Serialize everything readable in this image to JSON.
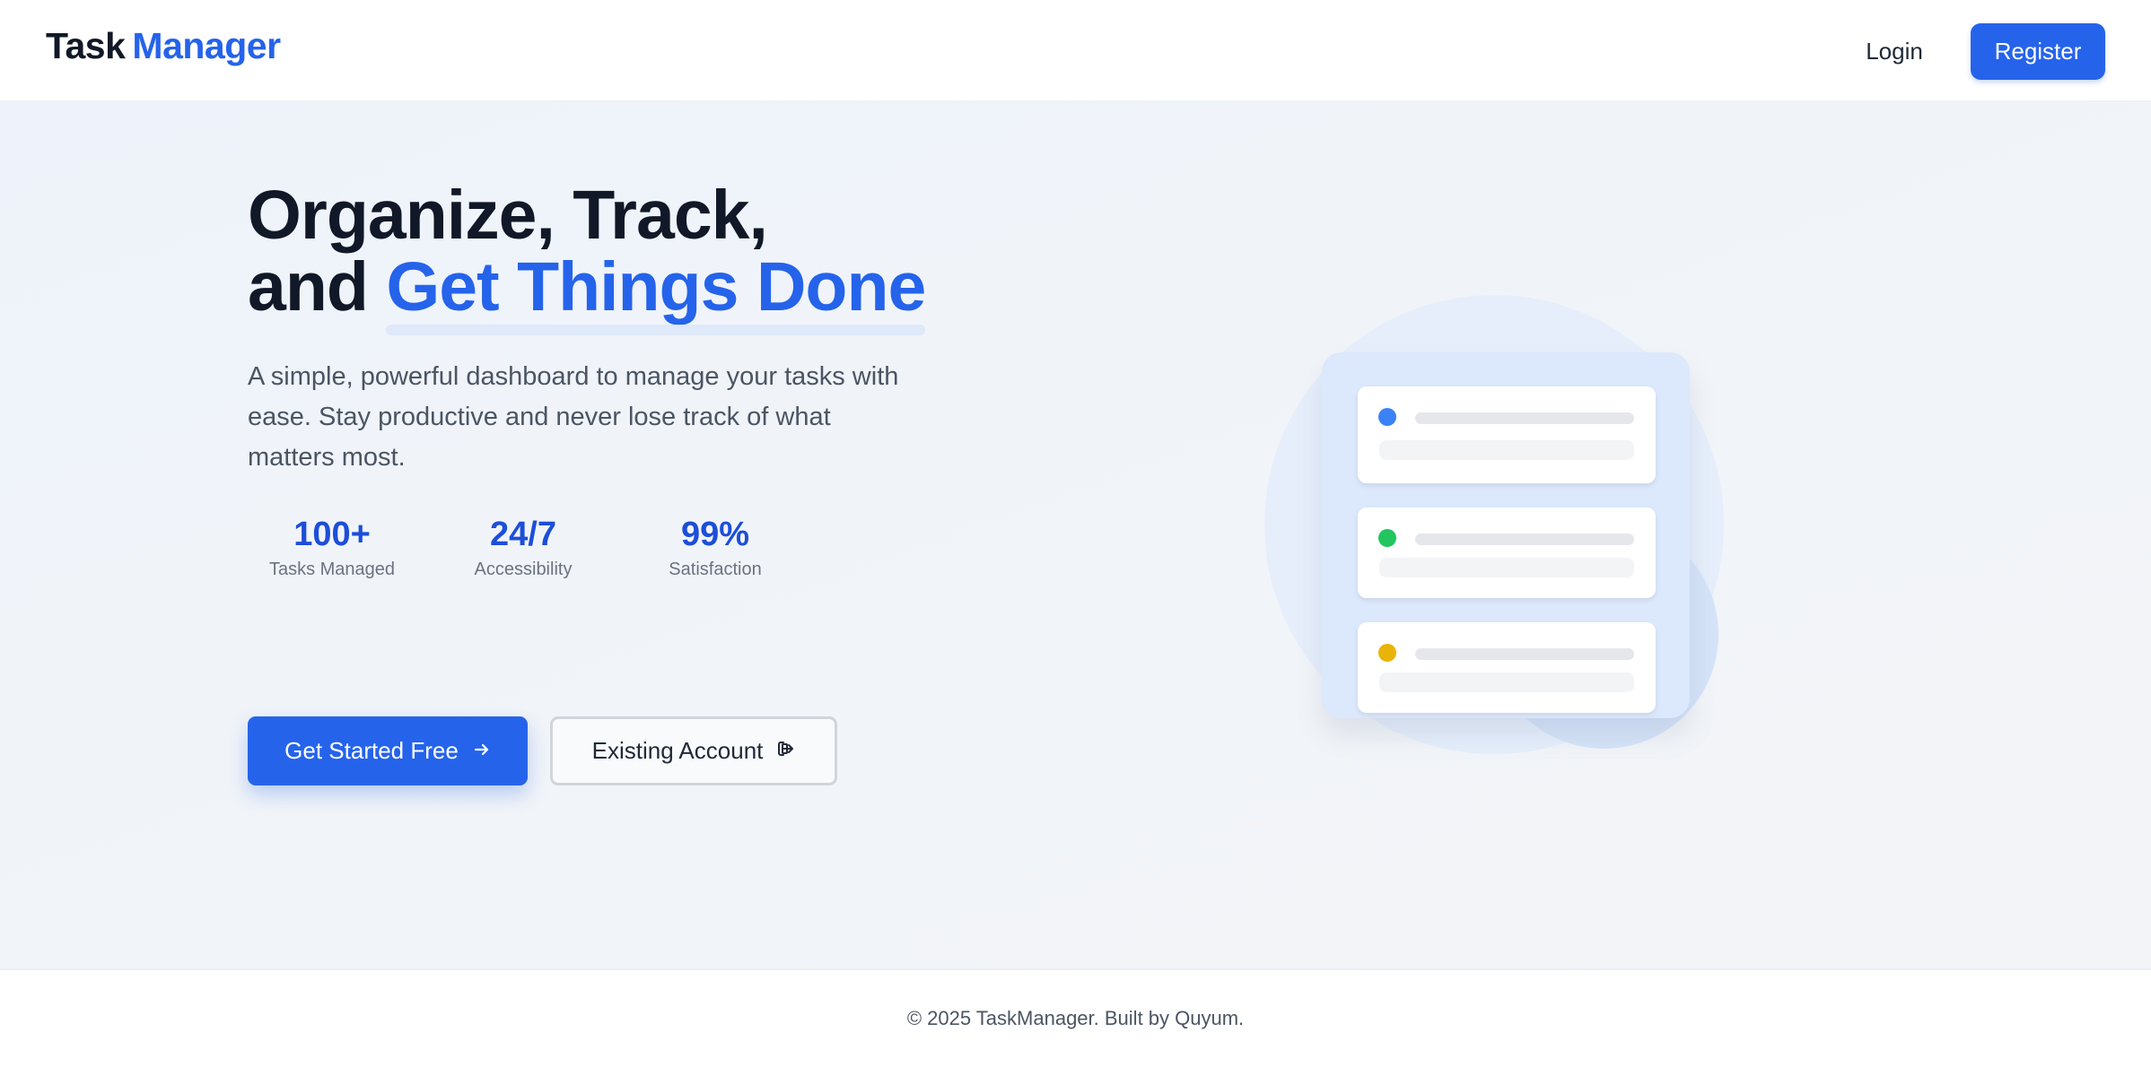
{
  "nav": {
    "brand_part1": "Task",
    "brand_part2": "Manager",
    "login_label": "Login",
    "register_label": "Register"
  },
  "hero": {
    "headline_line1": "Organize, Track,",
    "headline_line2_prefix": "and",
    "headline_line2_accent": "Get Things Done",
    "subtitle": "A simple, powerful dashboard to manage your tasks with ease. Stay productive and never lose track of what matters most.",
    "stats": [
      {
        "value": "100+",
        "label": "Tasks Managed"
      },
      {
        "value": "24/7",
        "label": "Accessibility"
      },
      {
        "value": "99%",
        "label": "Satisfaction"
      }
    ],
    "primary_button_label": "Get Started Free",
    "primary_button_icon": "arrow-right-icon",
    "secondary_button_label": "Existing Account",
    "secondary_button_icon": "login-icon"
  },
  "illustration": {
    "task_dot_colors": [
      "#3b82f6",
      "#22c55e",
      "#eab308"
    ]
  },
  "footer": {
    "copyright": "© 2025 TaskManager. Built by Quyum."
  },
  "colors": {
    "accent": "#2563eb",
    "heading": "#111827",
    "body_text": "#4b5563"
  }
}
